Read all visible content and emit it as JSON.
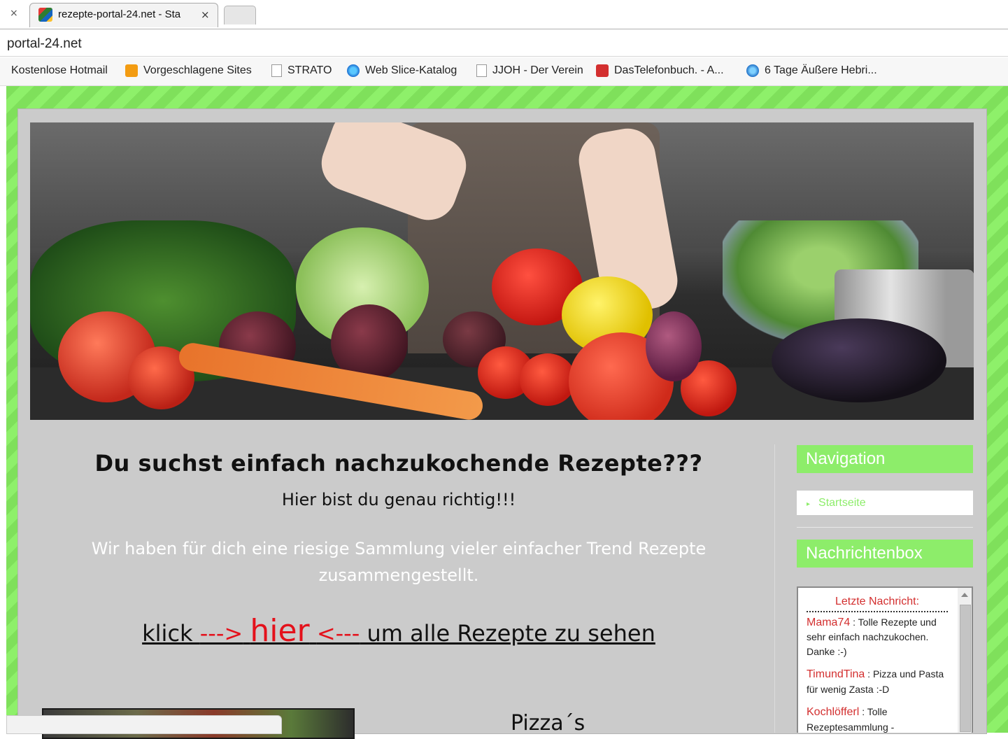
{
  "browser": {
    "tab_title": "rezepte-portal-24.net - Sta",
    "tab_close": "×",
    "left_close": "×",
    "address": "portal-24.net"
  },
  "bookmarks": [
    {
      "label": "Kostenlose Hotmail",
      "icon": "none"
    },
    {
      "label": "Vorgeschlagene Sites",
      "icon": "suggested-sites-icon"
    },
    {
      "label": "STRATO",
      "icon": "page-icon"
    },
    {
      "label": "Web Slice-Katalog",
      "icon": "ie-icon"
    },
    {
      "label": "JJOH - Der Verein",
      "icon": "page-icon"
    },
    {
      "label": "DasTelefonbuch. - A...",
      "icon": "telefonbuch-icon"
    },
    {
      "label": "6 Tage Äußere Hebri...",
      "icon": "globe-icon"
    }
  ],
  "main": {
    "headline": "Du suchst einfach nachzukochende Rezepte???",
    "subheadline": "Hier bist du genau richtig!!!",
    "intro": "Wir haben für dich eine riesige Sammlung vieler einfacher Trend Rezepte zusammengestellt.",
    "klick_prefix": "klick ",
    "arrow_right": "--->",
    "hier": "hier",
    "arrow_left": "<---",
    "klick_suffix": " um alle Rezepte zu sehen",
    "pizza_title": "Pizza´s"
  },
  "sidebar": {
    "nav_title": "Navigation",
    "nav_items": [
      "Startseite"
    ],
    "news_title": "Nachrichtenbox",
    "news_box_title": "Letzte Nachricht:",
    "messages": [
      {
        "user": "Mama74",
        "text": "Tolle Rezepte und sehr einfach nachzukochen. Danke :-)"
      },
      {
        "user": "TimundTina",
        "text": "Pizza und Pasta für wenig Zasta :-D"
      },
      {
        "user": "Kochlöfferl",
        "text": "Tolle Rezeptesammlung -"
      }
    ]
  },
  "colors": {
    "accent_green": "#8ded6a",
    "link_red": "#e4111b",
    "content_bg": "#cbcbcb"
  }
}
